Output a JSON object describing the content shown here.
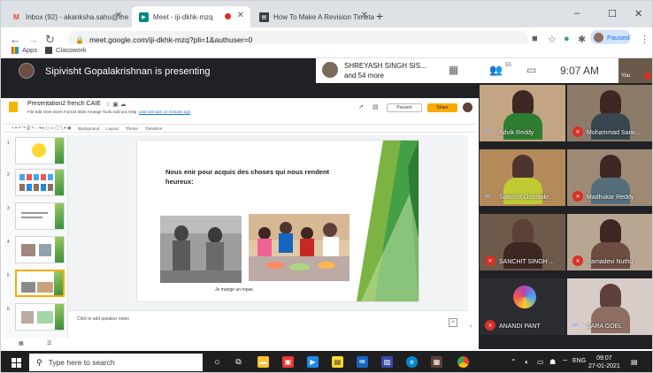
{
  "browser": {
    "tabs": [
      {
        "title": "Inbox (92) - akanksha.sahu@the",
        "icon": "gmail-icon",
        "active": false
      },
      {
        "title": "Meet - iji-dkhk-mzq",
        "icon": "meet-icon",
        "active": true,
        "recording": true
      },
      {
        "title": "How To Make A Revision Timetal",
        "icon": "doc-icon",
        "active": false
      }
    ],
    "new_tab": "+",
    "window_controls": [
      "–",
      "☐",
      "✕"
    ],
    "url": "meet.google.com/iji-dkhk-mzq?pli=1&authuser=0",
    "profile_status": "Paused",
    "bookmarks": [
      {
        "label": "Apps",
        "icon": "apps-grid-icon"
      },
      {
        "label": "Classwork",
        "icon": "classwork-icon"
      }
    ]
  },
  "meet": {
    "presenting_text": "Sipivisht Gopalakrishnan is presenting",
    "presenter_name": "SHREYASH SINGH SIS...",
    "others": "and 54 more",
    "participant_count": "55",
    "time": "9:07 AM",
    "self_label": "You",
    "participants": [
      {
        "name": "Advik Reddy",
        "muted": false,
        "bg": "#c4a583",
        "body": "#2e7d32"
      },
      {
        "name": "Mohammad Sarw...",
        "muted": true,
        "bg": "#8d7b6a",
        "body": "#37474f"
      },
      {
        "name": "Sipivisht Gopalakr...",
        "muted": false,
        "bg": "#b58a5a",
        "body": "#c0ca33"
      },
      {
        "name": "Madhukar Reddy",
        "muted": true,
        "bg": "#9e8a74",
        "body": "#546e7a"
      },
      {
        "name": "SANCHIT SINGH ...",
        "muted": true,
        "bg": "#6d5a4a",
        "body": "#3e2723"
      },
      {
        "name": "Ramadevi Nuthu",
        "muted": true,
        "bg": "#b7a691",
        "body": "#6d4c41"
      },
      {
        "name": "ANANDI PANT",
        "muted": true,
        "bg": "#2b2c30",
        "body": "#2b2c30"
      },
      {
        "name": "SARA GOEL",
        "muted": false,
        "bg": "#d7ccc8",
        "body": "#8d6e63"
      }
    ]
  },
  "slides": {
    "doc_title": "Presentation2 french CAIE",
    "menus": "File  Edit  View  Insert  Format  Slide  Arrange  Tools  Add-ons  Help",
    "last_edit": "Last edit was 10 minutes ago",
    "present_label": "Present",
    "share_label": "Share",
    "toolbar_items": [
      "Background",
      "Layout",
      "Theme",
      "Transition"
    ],
    "slide_text": "Nous enir pour acquis des choses qui nous rendent heureux:",
    "caption": "Je mange un repas",
    "notes_placeholder": "Click to add speaker notes",
    "thumb_count": 6
  },
  "taskbar": {
    "search_placeholder": "Type here to search",
    "language": "ENG",
    "time": "09:07",
    "date": "27-01-2021"
  },
  "colors": {
    "meet_bg": "#202124",
    "accent_yellow": "#f9ab00",
    "mic_red": "#d93025",
    "slide_green": "#43a047"
  }
}
